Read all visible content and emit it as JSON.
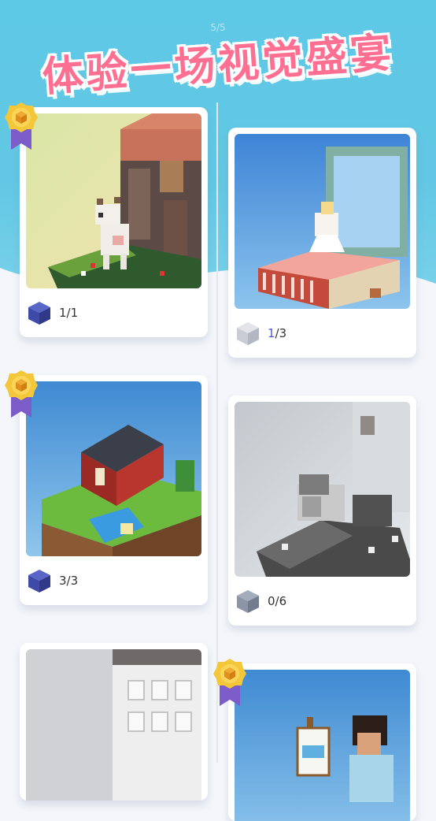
{
  "banner": {
    "title": "体验一场视觉盛宴",
    "page_indicator": "5/5"
  },
  "cards": [
    {
      "name": "llama-castle",
      "count": "1/1",
      "complete": true,
      "badge": true
    },
    {
      "name": "music-box-ballerina",
      "count_current": "1",
      "count_rest": "/3",
      "complete": false,
      "badge": false
    },
    {
      "name": "red-house-island",
      "count": "3/3",
      "complete": true,
      "badge": true
    },
    {
      "name": "sheep-on-rock",
      "count": "0/6",
      "complete": false,
      "badge": false
    },
    {
      "name": "white-building",
      "count": "",
      "complete": false,
      "badge": false
    },
    {
      "name": "painter-easel",
      "count": "",
      "complete": true,
      "badge": true
    }
  ],
  "colors": {
    "accent": "#ff6f92",
    "sky": "#5ec9e6",
    "cube_complete": "#3f4aa6",
    "cube_partial": "#c9ccd4",
    "cube_zero": "#8b95a5"
  }
}
